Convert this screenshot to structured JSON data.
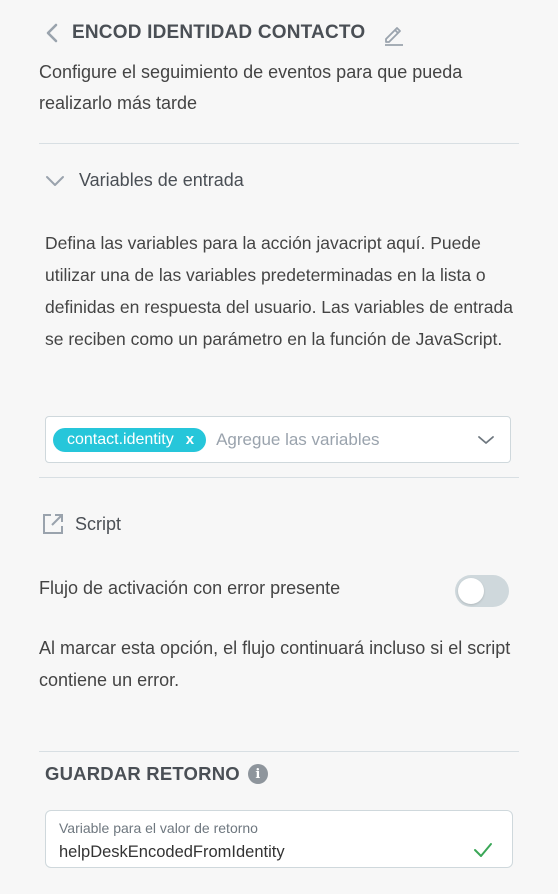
{
  "header": {
    "title": "ENCOD IDENTIDAD CONTACTO",
    "subtitle": "Configure el seguimiento de eventos para que pueda realizarlo más tarde"
  },
  "input_vars": {
    "section_label": "Variables de entrada",
    "description": "Defina las variables para la acción javacript aquí. Puede utilizar una de las variables predeterminadas en la lista o definidas en respuesta del usuario. Las variables de entrada se reciben como un parámetro en la función de JavaScript.",
    "chip_label": "contact.identity",
    "chip_remove": "x",
    "placeholder": "Agregue las variables"
  },
  "script": {
    "label": "Script"
  },
  "error_toggle": {
    "label": "Flujo de activación con error presente",
    "enabled": false,
    "note": "Al marcar esta opción, el flujo continuará incluso si el script contiene un error."
  },
  "return_section": {
    "title": "GUARDAR RETORNO",
    "info_icon": "i",
    "field_label": "Variable para el valor de retorno",
    "field_value": "helpDeskEncodedFromIdentity"
  },
  "colors": {
    "accent": "#26c6da",
    "check": "#3aa757",
    "toggle_off": "#cfd8dc"
  }
}
